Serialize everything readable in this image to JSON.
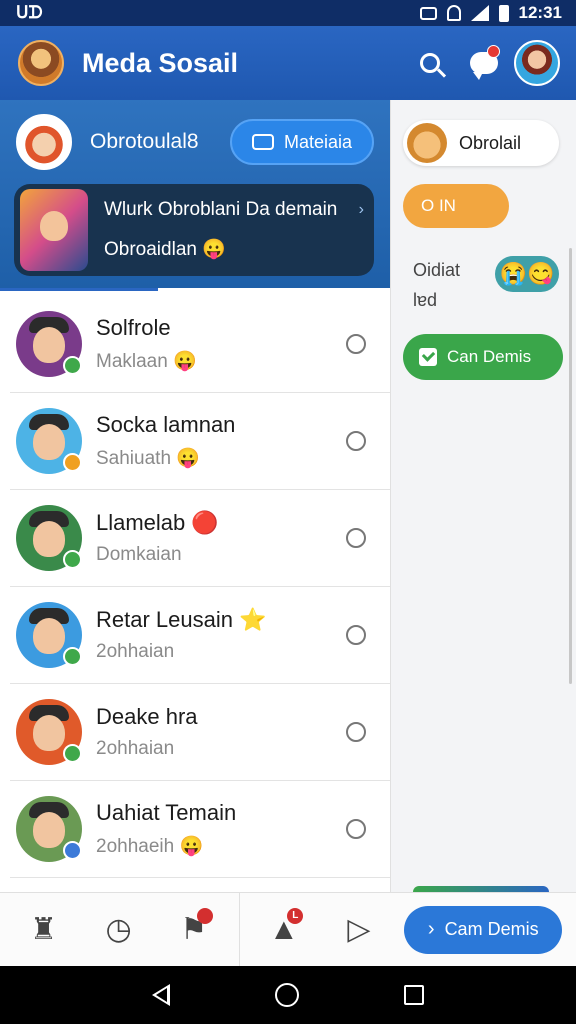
{
  "status_bar": {
    "left_text": "ᑌᗪ",
    "time": "12:31"
  },
  "header": {
    "title": "Meda Sosail"
  },
  "profile": {
    "name": "Obrotoulal8",
    "action_label": "Mateiaia"
  },
  "feature_card": {
    "title": "Wlurk Obroblani Da demain",
    "subtitle": "Obroaidlan 😛",
    "arrow": "›"
  },
  "contacts": [
    {
      "name": "Solfrole",
      "status": "Maklaan 😛",
      "avatar_bg": "#7a3b8a",
      "badge_color": "#3fa84a"
    },
    {
      "name": "Socka lamnan",
      "status": "Sahiuath 😛",
      "avatar_bg": "#4db3e6",
      "badge_color": "#f0a020"
    },
    {
      "name": "Llamelab 🔴",
      "status": "Domkaian",
      "avatar_bg": "#3a8a4a",
      "badge_color": "#3fa84a"
    },
    {
      "name": "Retar Leusain ⭐",
      "status": "2ohhaian",
      "avatar_bg": "#3c9be0",
      "badge_color": "#3fa84a"
    },
    {
      "name": "Deake hra",
      "status": "2ohhaian",
      "avatar_bg": "#e05a2a",
      "badge_color": "#3fa84a"
    },
    {
      "name": "Uahiat Temain",
      "status": "2ohhaeih 😛",
      "avatar_bg": "#6a9a54",
      "badge_color": "#3c7ad8"
    }
  ],
  "right_panel": {
    "chip_label": "Obrolail",
    "orange_label": "O IN",
    "text_line1": "Oidiat",
    "text_line2": "lɐd",
    "emoji": "😭😋",
    "green_label": "Can Demis"
  },
  "bottom_bar": {
    "cta_label": "Cam Demis",
    "badge_1": "",
    "badge_2": "L"
  }
}
